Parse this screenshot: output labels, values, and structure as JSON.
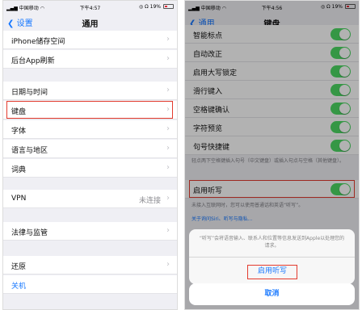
{
  "left": {
    "status": {
      "carrier": "中国移动",
      "time": "下午4:57",
      "battery": "19%"
    },
    "nav": {
      "back": "设置",
      "title": "通用"
    },
    "rows": {
      "storage": "iPhone储存空间",
      "bg_refresh": "后台App刷新",
      "datetime": "日期与时间",
      "keyboard": "键盘",
      "font": "字体",
      "language": "语言与地区",
      "dictionary": "词典",
      "vpn": "VPN",
      "vpn_status": "未连接",
      "legal": "法律与监管",
      "reset": "还原",
      "shutdown": "关机"
    }
  },
  "right": {
    "status": {
      "carrier": "中国移动",
      "time": "下午4:56",
      "battery": "19%"
    },
    "nav": {
      "back": "通用",
      "title": "键盘"
    },
    "rows": {
      "smart_punct": "智能标点",
      "autocorrect": "自动改正",
      "caps_lock": "启用大写锁定",
      "slide": "滑行键入",
      "space_confirm": "空格键确认",
      "char_preview": "字符预览",
      "period_shortcut": "句号快捷键",
      "dictation": "启用听写"
    },
    "footnote_period": "轻点两下空格键插入句号（中文键盘）或插入句点与空格（其他键盘）。",
    "footnote_dictation": "未接入互联网时，您可以使用普通话和英语“听写”。",
    "about_link": "关于询问Siri、听写与隐私...",
    "sheet": {
      "text": "“听写”会将语音输入、联系人和位置等信息发送到Apple以处理您的请求。",
      "enable": "启用听写",
      "cancel": "取消"
    }
  },
  "colors": {
    "accent": "#1677ff",
    "toggle_on": "#4cd964",
    "highlight": "#e33b2e"
  }
}
